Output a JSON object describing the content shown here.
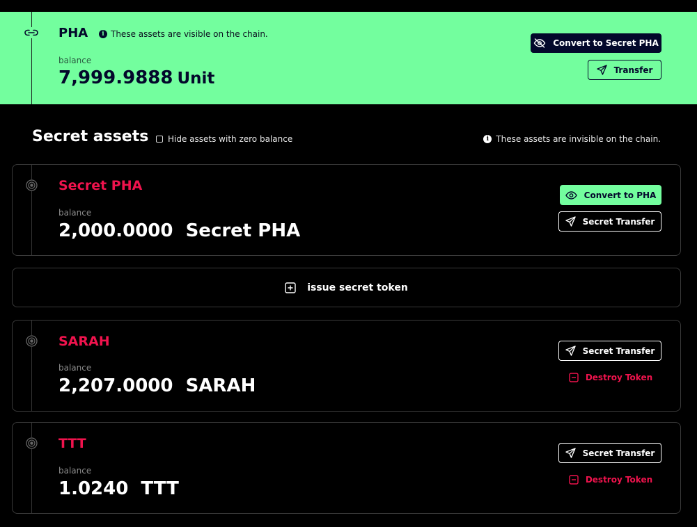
{
  "public_asset": {
    "name": "PHA",
    "visibility_note": "These assets are visible on the chain.",
    "balance_label": "balance",
    "balance": "7,999.9888",
    "unit": "Unit",
    "convert_label": "Convert to Secret PHA",
    "transfer_label": "Transfer"
  },
  "secret_section": {
    "title": "Secret assets",
    "hide_zero_label": "Hide assets with zero balance",
    "hide_zero_checked": false,
    "visibility_note": "These assets are invisible on the chain."
  },
  "secret_pha": {
    "name": "Secret PHA",
    "balance_label": "balance",
    "balance": "2,000.0000  Secret PHA",
    "convert_label": "Convert to PHA",
    "transfer_label": "Secret Transfer"
  },
  "issue_token": {
    "label": "issue secret token"
  },
  "tokens": [
    {
      "name": "SARAH",
      "balance_label": "balance",
      "balance": "2,207.0000  SARAH",
      "transfer_label": "Secret Transfer",
      "destroy_label": "Destroy Token"
    },
    {
      "name": "TTT",
      "balance_label": "balance",
      "balance": "1.0240  TTT",
      "transfer_label": "Secret Transfer",
      "destroy_label": "Destroy Token"
    }
  ],
  "colors": {
    "accent_green": "#73fe9e",
    "navy": "#03082b",
    "secret_red": "#f0134d",
    "background": "#000000"
  },
  "icons": [
    "link-icon",
    "info-icon",
    "eye-off-icon",
    "send-icon",
    "eye-icon",
    "coin-icon",
    "plus-square-icon",
    "minus-square-icon"
  ]
}
